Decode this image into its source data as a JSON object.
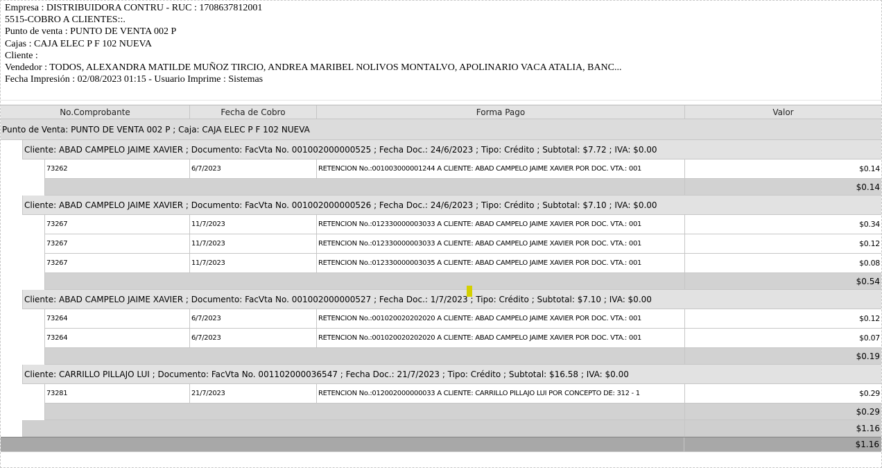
{
  "header": {
    "empresa": "Empresa : DISTRIBUIDORA CONTRU   -   RUC : 1708637812001",
    "reporte": "5515-COBRO A CLIENTES::.",
    "punto_venta": "Punto de venta : PUNTO DE VENTA 002 P",
    "cajas": "Cajas : CAJA ELEC P F 102 NUEVA",
    "cliente": "Cliente :",
    "vendedor": "Vendedor : TODOS, ALEXANDRA MATILDE MUÑOZ TIRCIO, ANDREA MARIBEL NOLIVOS MONTALVO, APOLINARIO VACA ATALIA, BANC...",
    "fecha_impresion": "Fecha Impresión : 02/08/2023 01:15  -  Usuario Imprime : Sistemas"
  },
  "columns": [
    "No.Comprobante",
    "Fecha de Cobro",
    "Forma Pago",
    "Valor"
  ],
  "pv_group": "Punto de Venta: PUNTO DE VENTA 002 P ; Caja: CAJA ELEC P F 102 NUEVA",
  "clients": [
    {
      "label": "Cliente: ABAD CAMPELO JAIME XAVIER ; Documento: FacVta No. 001002000000525 ; Fecha Doc.: 24/6/2023 ; Tipo: Crédito ; Subtotal: $7.72 ; IVA: $0.00",
      "rows": [
        {
          "comprobante": "73262",
          "fecha": "6/7/2023",
          "forma": "RETENCION No.:001003000001244 A CLIENTE: ABAD CAMPELO JAIME XAVIER POR DOC. VTA.: 001",
          "valor": "$0.14"
        }
      ],
      "subtotal": "$0.14"
    },
    {
      "label": "Cliente: ABAD CAMPELO JAIME XAVIER ; Documento: FacVta No. 001002000000526 ; Fecha Doc.: 24/6/2023 ; Tipo: Crédito ; Subtotal: $7.10 ; IVA: $0.00",
      "rows": [
        {
          "comprobante": "73267",
          "fecha": "11/7/2023",
          "forma": "RETENCION No.:012330000003033 A CLIENTE: ABAD CAMPELO JAIME XAVIER POR DOC. VTA.: 001",
          "valor": "$0.34"
        },
        {
          "comprobante": "73267",
          "fecha": "11/7/2023",
          "forma": "RETENCION No.:012330000003033 A CLIENTE: ABAD CAMPELO JAIME XAVIER POR DOC. VTA.: 001",
          "valor": "$0.12"
        },
        {
          "comprobante": "73267",
          "fecha": "11/7/2023",
          "forma": "RETENCION No.:012330000003035 A CLIENTE: ABAD CAMPELO JAIME XAVIER POR DOC. VTA.: 001",
          "valor": "$0.08"
        }
      ],
      "subtotal": "$0.54"
    },
    {
      "label": "Cliente: ABAD CAMPELO JAIME XAVIER ; Documento: FacVta No. 001002000000527 ; Fecha Doc.: 1/7/2023 ; Tipo: Crédito ; Subtotal: $7.10 ; IVA: $0.00",
      "rows": [
        {
          "comprobante": "73264",
          "fecha": "6/7/2023",
          "forma": "RETENCION No.:001020020202020 A CLIENTE: ABAD CAMPELO JAIME XAVIER POR DOC. VTA.: 001",
          "valor": "$0.12"
        },
        {
          "comprobante": "73264",
          "fecha": "6/7/2023",
          "forma": "RETENCION No.:001020020202020 A CLIENTE: ABAD CAMPELO JAIME XAVIER POR DOC. VTA.: 001",
          "valor": "$0.07"
        }
      ],
      "subtotal": "$0.19"
    },
    {
      "label": "Cliente: CARRILLO PILLAJO LUI ; Documento: FacVta No. 001102000036547 ; Fecha Doc.: 21/7/2023 ; Tipo: Crédito ; Subtotal: $16.58 ; IVA: $0.00",
      "rows": [
        {
          "comprobante": "73281",
          "fecha": "21/7/2023",
          "forma": "RETENCION No.:012002000000033 A CLIENTE: CARRILLO PILLAJO LUI POR CONCEPTO DE: 312 - 1",
          "valor": "$0.29"
        }
      ],
      "subtotal": "$0.29"
    }
  ],
  "pv_total": "$1.16",
  "grand_total": "$1.16",
  "colors": {
    "marker": "#d4d000",
    "group_bg": "#dcdcdc",
    "total_bg": "#a8a8a8"
  }
}
